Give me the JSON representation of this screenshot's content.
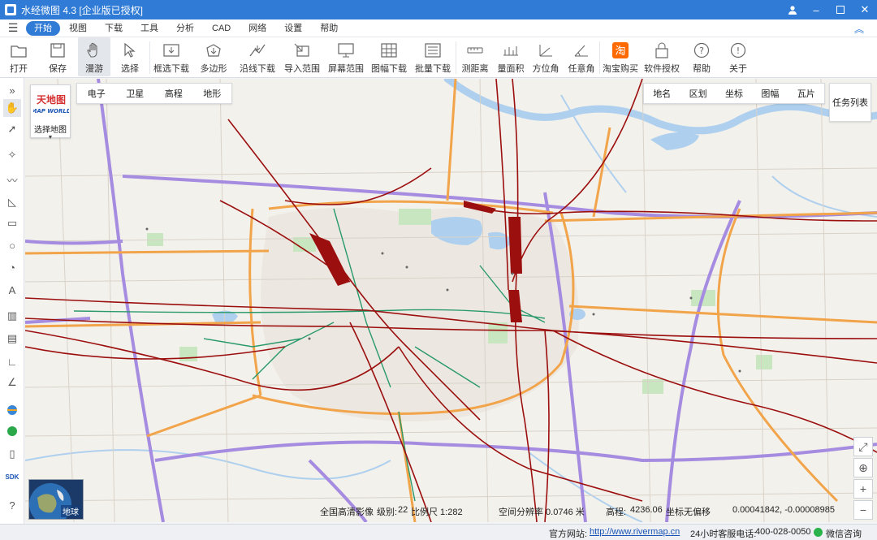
{
  "window": {
    "title": "水经微图 4.3 [企业版已授权]",
    "controls": [
      "user-icon",
      "minimize-icon",
      "maximize-icon",
      "close-icon"
    ]
  },
  "menu": {
    "items": [
      "开始",
      "视图",
      "下载",
      "工具",
      "分析",
      "CAD",
      "网络",
      "设置",
      "帮助"
    ],
    "active": "开始"
  },
  "toolbar": {
    "items": [
      {
        "label": "打开",
        "icon": "folder-icon"
      },
      {
        "label": "保存",
        "icon": "save-icon"
      },
      {
        "label": "漫游",
        "icon": "hand-icon",
        "active": true
      },
      {
        "label": "选择",
        "icon": "cursor-icon"
      },
      {
        "label": "框选下载",
        "icon": "rect-download-icon"
      },
      {
        "label": "多边形",
        "icon": "polygon-download-icon"
      },
      {
        "label": "沿线下载",
        "icon": "line-download-icon"
      },
      {
        "label": "导入范围",
        "icon": "import-range-icon"
      },
      {
        "label": "屏幕范围",
        "icon": "screen-range-icon"
      },
      {
        "label": "图幅下载",
        "icon": "sheet-download-icon"
      },
      {
        "label": "批量下载",
        "icon": "batch-download-icon"
      },
      {
        "label": "测距离",
        "icon": "ruler-icon"
      },
      {
        "label": "量面积",
        "icon": "area-icon"
      },
      {
        "label": "方位角",
        "icon": "azimuth-icon"
      },
      {
        "label": "任意角",
        "icon": "angle-icon"
      },
      {
        "label": "淘宝购买",
        "icon": "taobao-icon"
      },
      {
        "label": "软件授权",
        "icon": "lock-icon"
      },
      {
        "label": "帮助",
        "icon": "help-icon"
      },
      {
        "label": "关于",
        "icon": "info-icon"
      }
    ]
  },
  "map": {
    "logo_text": "天地图",
    "logo_sub": "MAP WORLD",
    "select_map": "选择地图",
    "layer_tabs": [
      "电子",
      "卫星",
      "高程",
      "地形"
    ],
    "search_tabs": [
      "地名",
      "区划",
      "坐标",
      "图幅",
      "瓦片"
    ],
    "task_list": "任务列表",
    "globe_label": "地球",
    "status": {
      "imagery": "全国高清影像",
      "level_label": "级别:",
      "level": "22",
      "scale": "比例尺 1:282",
      "resolution": "空间分辨率 0.0746 米",
      "elevation_label": "高程:",
      "elevation": "4236.06",
      "coord_system": "坐标无偏移",
      "coords": "0.00041842, -0.00008985"
    },
    "colors": {
      "water": "#aed0ee",
      "green": "#c8e6c0",
      "highway": "#f2a44a",
      "ring_road": "#a58ce0",
      "railway": "#9b0f0f",
      "metro": "#2a9a6a"
    }
  },
  "statusbar": {
    "site_label": "官方网站:",
    "site_url": "http://www.rivermap.cn",
    "phone_label": "24小时客服电话:",
    "phone": "400-028-0050",
    "wechat": "微信咨询"
  }
}
